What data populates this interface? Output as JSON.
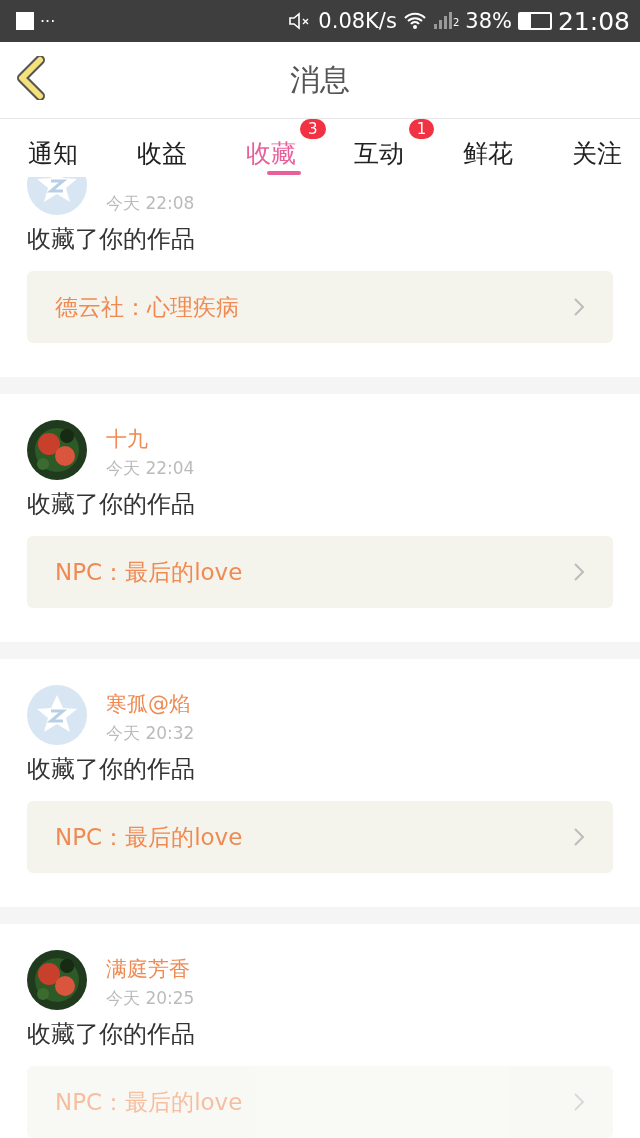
{
  "status_bar": {
    "dots": "···",
    "speed": "0.08K/s",
    "sim": "2",
    "battery": "38%",
    "time": "21:08"
  },
  "header": {
    "title": "消息"
  },
  "tabs": [
    {
      "label": "通知",
      "selected": false
    },
    {
      "label": "收益",
      "selected": false
    },
    {
      "label": "收藏",
      "selected": true,
      "badge": "3"
    },
    {
      "label": "互动",
      "selected": false,
      "badge": "1"
    },
    {
      "label": "鲜花",
      "selected": false
    },
    {
      "label": "关注",
      "selected": false
    }
  ],
  "messages": [
    {
      "kind": "default",
      "time": "今天 22:08",
      "text": "收藏了你的作品",
      "work": "德云社：心理疾病"
    },
    {
      "kind": "picture",
      "name": "十九",
      "time": "今天 22:04",
      "text": "收藏了你的作品",
      "work": "NPC：最后的love"
    },
    {
      "kind": "default",
      "name": "寒孤@焰",
      "time": "今天 20:32",
      "text": "收藏了你的作品",
      "work": "NPC：最后的love"
    },
    {
      "kind": "picture",
      "name": "满庭芳香",
      "time": "今天 20:25",
      "text": "收藏了你的作品",
      "work": "NPC：最后的love"
    }
  ]
}
